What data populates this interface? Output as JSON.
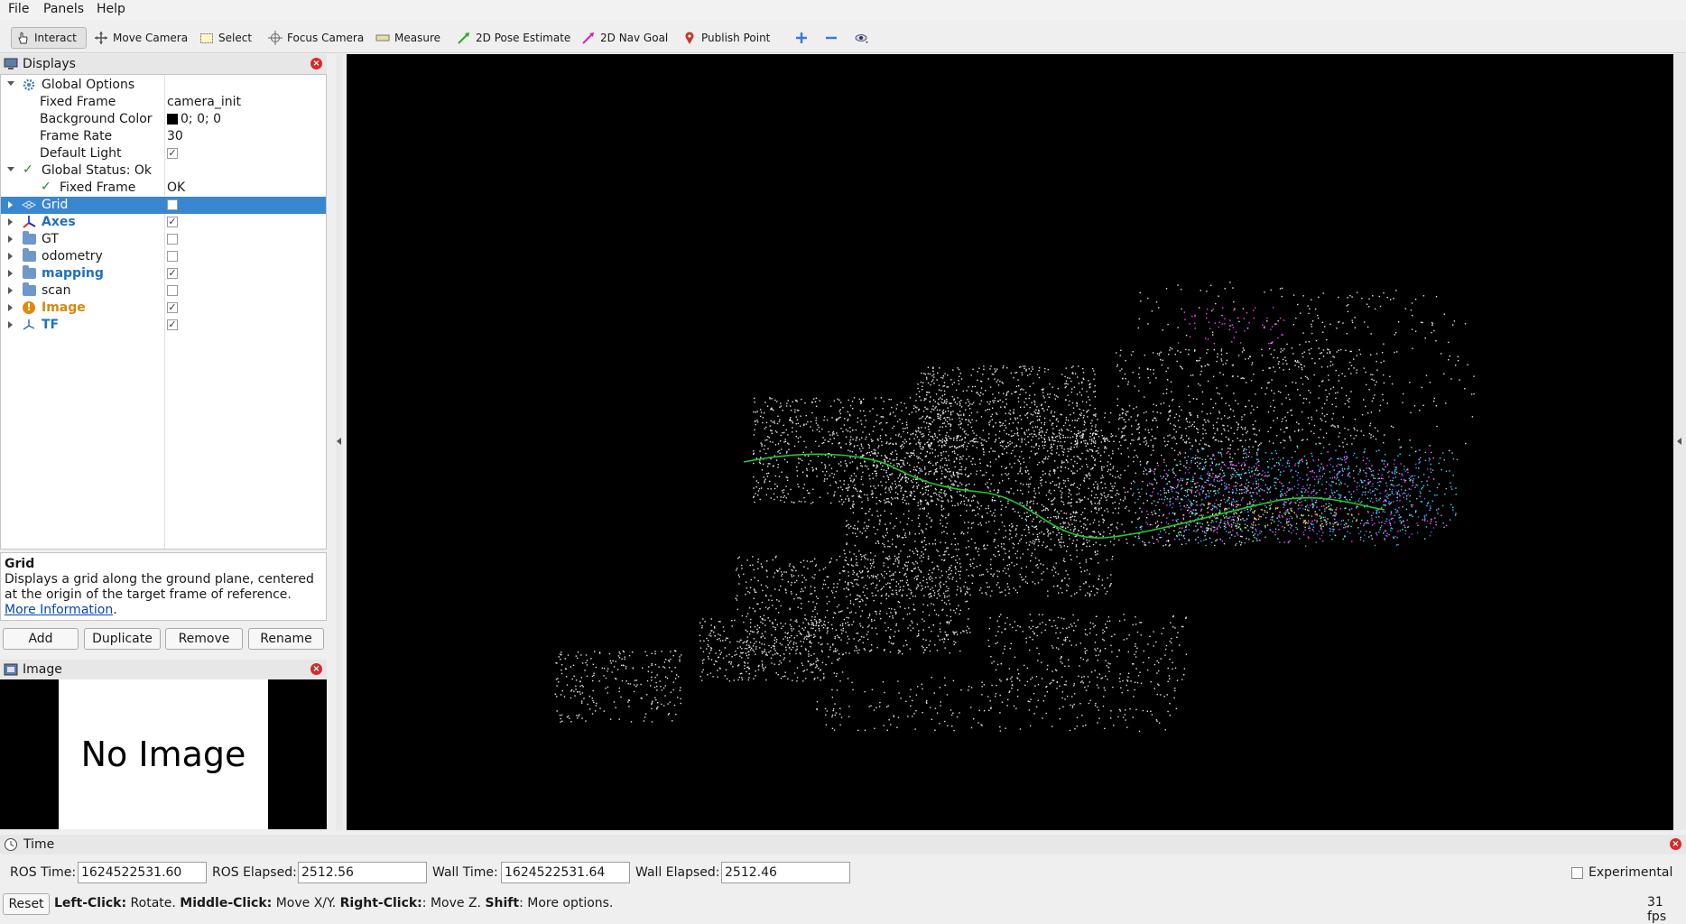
{
  "menubar": {
    "file": "File",
    "panels": "Panels",
    "help": "Help"
  },
  "toolbar": {
    "interact": "Interact",
    "move_camera": "Move Camera",
    "select": "Select",
    "focus_camera": "Focus Camera",
    "measure": "Measure",
    "pose_estimate": "2D Pose Estimate",
    "nav_goal": "2D Nav Goal",
    "publish_point": "Publish Point"
  },
  "displays": {
    "title": "Displays",
    "global_options": "Global Options",
    "fixed_frame_label": "Fixed Frame",
    "fixed_frame_value": "camera_init",
    "bg_color_label": "Background Color",
    "bg_color_value": "0; 0; 0",
    "frame_rate_label": "Frame Rate",
    "frame_rate_value": "30",
    "default_light_label": "Default Light",
    "global_status": "Global Status: Ok",
    "status_fixed_frame_label": "Fixed Frame",
    "status_fixed_frame_value": "OK",
    "items": [
      {
        "label": "Grid",
        "checked": false
      },
      {
        "label": "Axes",
        "checked": true
      },
      {
        "label": "GT",
        "checked": false
      },
      {
        "label": "odometry",
        "checked": false
      },
      {
        "label": "mapping",
        "checked": true
      },
      {
        "label": "scan",
        "checked": false
      },
      {
        "label": "Image",
        "checked": true
      },
      {
        "label": "TF",
        "checked": true
      }
    ]
  },
  "description": {
    "title": "Grid",
    "text": "Displays a grid along the ground plane, centered at the origin of the target frame of reference.",
    "link1": "More",
    "link2": "Information",
    "period": "."
  },
  "buttons": {
    "add": "Add",
    "duplicate": "Duplicate",
    "remove": "Remove",
    "rename": "Rename"
  },
  "image_panel": {
    "title": "Image",
    "placeholder": "No Image"
  },
  "time_panel": {
    "title": "Time",
    "ros_time_label": "ROS Time:",
    "ros_time": "1624522531.60",
    "ros_elapsed_label": "ROS Elapsed:",
    "ros_elapsed": "2512.56",
    "wall_time_label": "Wall Time:",
    "wall_time": "1624522531.64",
    "wall_elapsed_label": "Wall Elapsed:",
    "wall_elapsed": "2512.46",
    "experimental": "Experimental"
  },
  "statusbar": {
    "reset": "Reset",
    "left_click": "Left-Click:",
    "left_click_desc": " Rotate. ",
    "middle_click": "Middle-Click:",
    "middle_click_desc": " Move X/Y. ",
    "right_click": "Right-Click:",
    "right_click_desc": ": Move Z. ",
    "shift": "Shift",
    "shift_desc": ": More options.",
    "fps": "31 fps"
  },
  "colors": {
    "selection": "#3a87d1",
    "link_blue": "#1f6fbf",
    "warning": "#d8860b",
    "trajectory": "#22c832"
  }
}
